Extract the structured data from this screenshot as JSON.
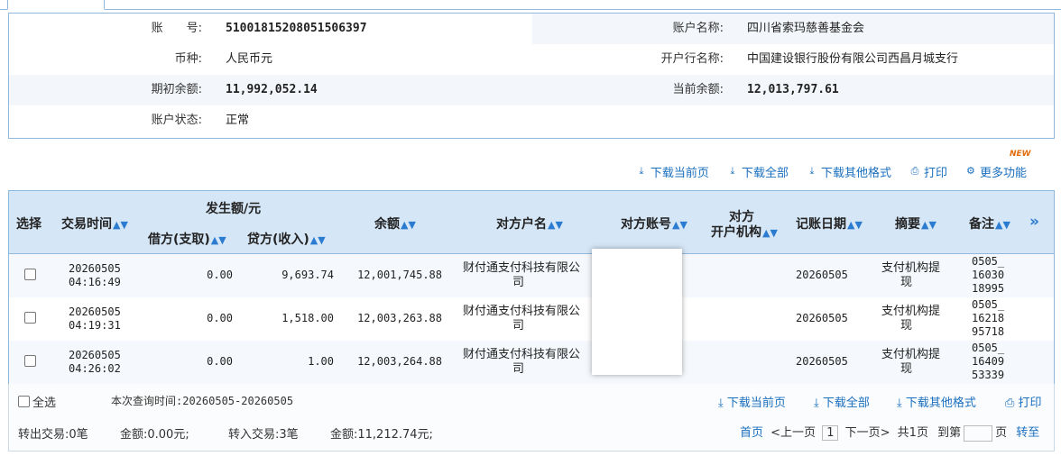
{
  "account": {
    "account_no_label": "账　　号:",
    "account_no": "51001815208051506397",
    "account_name_label": "账户名称:",
    "account_name": "四川省索玛慈善基金会",
    "currency_label": "币种:",
    "currency": "人民币元",
    "bank_label": "开户行名称:",
    "bank": "中国建设银行股份有限公司西昌月城支行",
    "opening_balance_label": "期初余额:",
    "opening_balance": "11,992,052.14",
    "current_balance_label": "当前余额:",
    "current_balance": "12,013,797.61",
    "status_label": "账户状态:",
    "status": "正常"
  },
  "toolbar": {
    "download_page": "下载当前页",
    "download_all": "下载全部",
    "download_other": "下载其他格式",
    "print": "打印",
    "more": "更多功能",
    "new_badge": "NEW"
  },
  "table": {
    "headers": {
      "select": "选择",
      "time": "交易时间",
      "amount_group": "发生额/元",
      "debit": "借方(支取)",
      "credit": "贷方(收入)",
      "balance": "余额",
      "counter_name": "对方户名",
      "counter_account": "对方账号",
      "counter_bank_1": "对方",
      "counter_bank_2": "开户机构",
      "post_date": "记账日期",
      "summary": "摘要",
      "remark": "备注",
      "more_cols": "»"
    },
    "rows": [
      {
        "date": "20260505",
        "time": "04:16:49",
        "debit": "0.00",
        "credit": "9,693.74",
        "balance": "12,001,745.88",
        "counter_name_1": "财付通支付科技有限公",
        "counter_name_2": "司",
        "post_date": "20260505",
        "summary_1": "支付机构提",
        "summary_2": "现",
        "remark_1": "0505_",
        "remark_2": "16030",
        "remark_3": "18995"
      },
      {
        "date": "20260505",
        "time": "04:19:31",
        "debit": "0.00",
        "credit": "1,518.00",
        "balance": "12,003,263.88",
        "counter_name_1": "财付通支付科技有限公",
        "counter_name_2": "司",
        "post_date": "20260505",
        "summary_1": "支付机构提",
        "summary_2": "现",
        "remark_1": "0505_",
        "remark_2": "16218",
        "remark_3": "95718"
      },
      {
        "date": "20260505",
        "time": "04:26:02",
        "debit": "0.00",
        "credit": "1.00",
        "balance": "12,003,264.88",
        "counter_name_1": "财付通支付科技有限公",
        "counter_name_2": "司",
        "post_date": "20260505",
        "summary_1": "支付机构提",
        "summary_2": "现",
        "remark_1": "0505_",
        "remark_2": "16409",
        "remark_3": "53339"
      }
    ]
  },
  "footer": {
    "select_all": "全选",
    "query_time": "本次查询时间:20260505-20260505",
    "download_page": "下载当前页",
    "download_all": "下载全部",
    "download_other": "下载其他格式",
    "print": "打印",
    "summary_out": "转出交易:0笔",
    "summary_out_amount": "金额:0.00元;",
    "summary_in": "转入交易:3笔",
    "summary_in_amount": "金额:11,212.74元;",
    "first": "首页",
    "prev": "<上一页",
    "page": "1",
    "next": "下一页>",
    "total": "共1页",
    "goto_label": "到第",
    "page_unit": "页",
    "go": "转至"
  }
}
